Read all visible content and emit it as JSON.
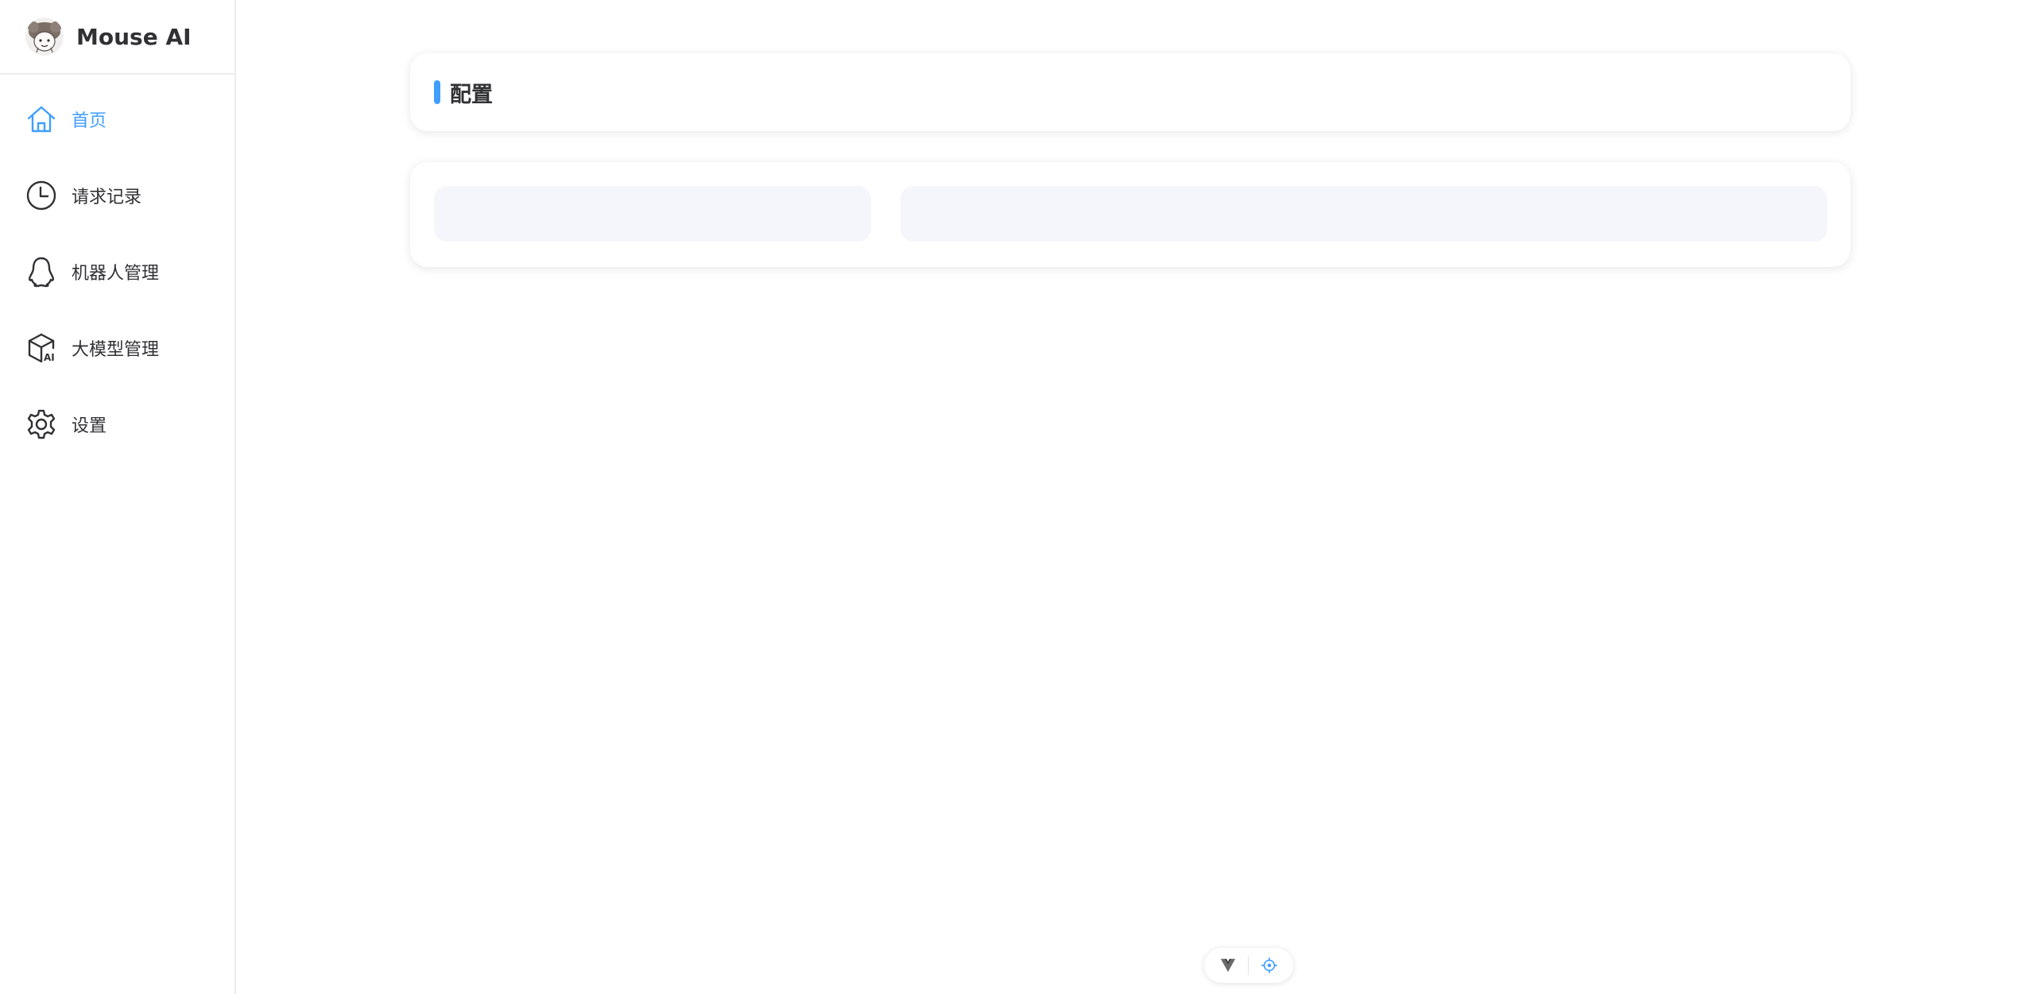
{
  "brand": {
    "name": "Mouse AI",
    "logo_icon": "mouse-avatar-icon"
  },
  "sidebar": {
    "items": [
      {
        "label": "首页",
        "icon": "home-icon",
        "active": true
      },
      {
        "label": "请求记录",
        "icon": "clock-icon",
        "active": false
      },
      {
        "label": "机器人管理",
        "icon": "qq-penguin-icon",
        "active": false
      },
      {
        "label": "大模型管理",
        "icon": "ai-cube-icon",
        "active": false
      },
      {
        "label": "设置",
        "icon": "gear-icon",
        "active": false
      }
    ]
  },
  "main": {
    "config_title": "配置"
  },
  "devtools": {
    "icons": [
      "vue-logo-icon",
      "crosshair-icon"
    ]
  },
  "colors": {
    "accent": "#409eff",
    "text": "#303133",
    "skeleton": "#f5f6fb"
  }
}
